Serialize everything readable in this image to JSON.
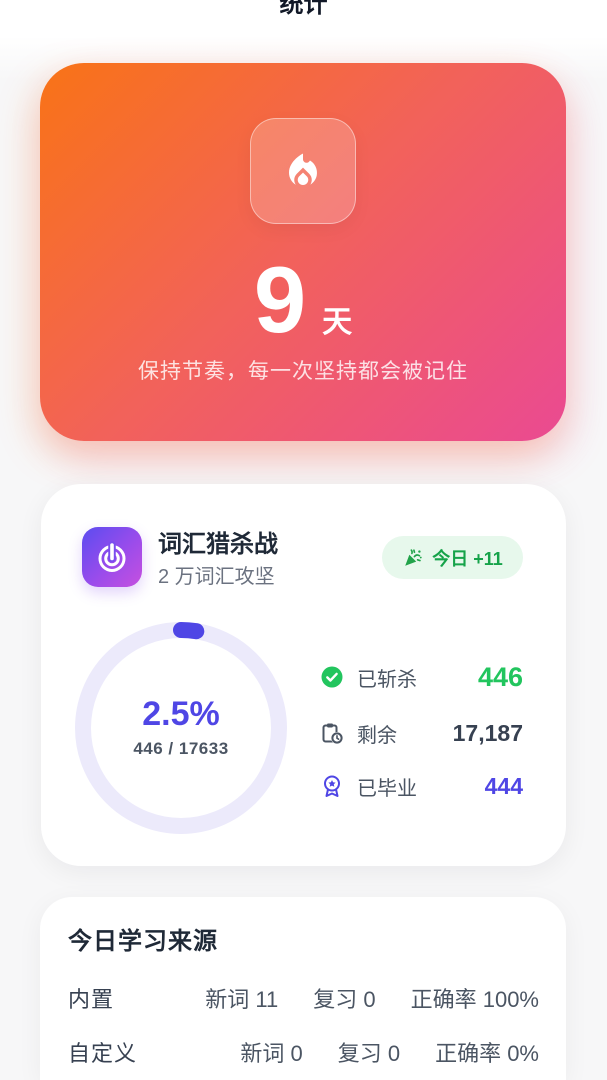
{
  "header": {
    "title": "统计"
  },
  "streak": {
    "icon": "flame-icon",
    "count": "9",
    "unit": "天",
    "subtitle": "保持节奏，每一次坚持都会被记住"
  },
  "vocab": {
    "icon": "target-icon",
    "title": "词汇猎杀战",
    "subtitle": "2 万词汇攻坚",
    "badge": {
      "icon": "party-popper-icon",
      "label": "今日 +11"
    },
    "progress": {
      "value": 0.025,
      "percent_label": "2.5%",
      "fraction_label": "446 / 17633"
    },
    "stats": [
      {
        "icon": "check-circle-icon",
        "label": "已斩杀",
        "value": "446",
        "color": "#22C55E"
      },
      {
        "icon": "clipboard-clock-icon",
        "label": "剩余",
        "value": "17,187",
        "color": "#374151"
      },
      {
        "icon": "award-icon",
        "label": "已毕业",
        "value": "444",
        "color": "#4F46E5"
      }
    ]
  },
  "sources": {
    "title": "今日学习来源",
    "rows": [
      {
        "name": "内置",
        "new_words": "新词 11",
        "review": "复习 0",
        "accuracy": "正确率 100%"
      },
      {
        "name": "自定义",
        "new_words": "新词 0",
        "review": "复习 0",
        "accuracy": "正确率 0%"
      }
    ]
  },
  "colors": {
    "streak_gradient_start": "#F97316",
    "streak_gradient_end": "#EC4899",
    "accent_purple": "#4F46E5",
    "success_green": "#22C55E",
    "ring_track": "#ECEAFB"
  }
}
